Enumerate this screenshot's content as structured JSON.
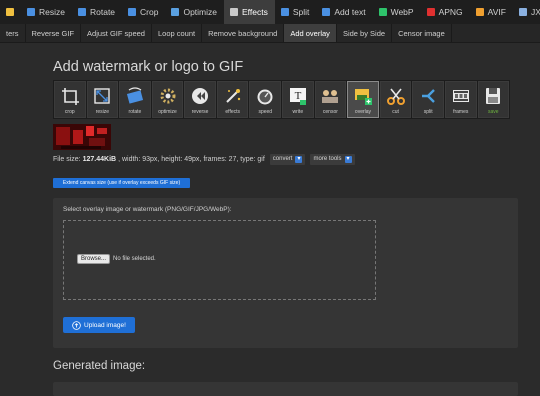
{
  "topnav": {
    "items": [
      {
        "label": "",
        "icon": "arrow-icon",
        "color": "#f0c040"
      },
      {
        "label": "Resize",
        "icon": "resize-icon",
        "color": "#4a90e2"
      },
      {
        "label": "Rotate",
        "icon": "rotate-icon",
        "color": "#4a90e2"
      },
      {
        "label": "Crop",
        "icon": "crop-icon",
        "color": "#4a90e2"
      },
      {
        "label": "Optimize",
        "icon": "optimize-icon",
        "color": "#5aa0e0"
      },
      {
        "label": "Effects",
        "icon": "effects-icon",
        "color": "#c9c9c9"
      },
      {
        "label": "Split",
        "icon": "split-icon",
        "color": "#4a90e2"
      },
      {
        "label": "Add text",
        "icon": "text-icon",
        "color": "#4a90e2"
      },
      {
        "label": "WebP",
        "icon": "webp-icon",
        "color": "#2ec36b"
      },
      {
        "label": "APNG",
        "icon": "apng-icon",
        "color": "#e03030"
      },
      {
        "label": "AVIF",
        "icon": "avif-icon",
        "color": "#f0a030"
      },
      {
        "label": "JXL",
        "icon": "jxl-icon",
        "color": "#8ab0e0"
      }
    ],
    "active_index": 5
  },
  "subnav": {
    "items": [
      "ters",
      "Reverse GIF",
      "Adjust GIF speed",
      "Loop count",
      "Remove background",
      "Add overlay",
      "Side by Side",
      "Censor image"
    ],
    "active_index": 5
  },
  "page": {
    "title": "Add watermark or logo to GIF",
    "generated_label": "Generated image:"
  },
  "tools": [
    {
      "label": "crop",
      "icon": "crop-tool-icon"
    },
    {
      "label": "resize",
      "icon": "resize-tool-icon"
    },
    {
      "label": "rotate",
      "icon": "rotate-tool-icon"
    },
    {
      "label": "optimize",
      "icon": "optimize-tool-icon"
    },
    {
      "label": "reverse",
      "icon": "reverse-tool-icon"
    },
    {
      "label": "effects",
      "icon": "effects-tool-icon"
    },
    {
      "label": "speed",
      "icon": "speed-tool-icon"
    },
    {
      "label": "write",
      "icon": "write-tool-icon"
    },
    {
      "label": "censor",
      "icon": "censor-tool-icon"
    },
    {
      "label": "overlay",
      "icon": "overlay-tool-icon"
    },
    {
      "label": "cut",
      "icon": "cut-tool-icon"
    },
    {
      "label": "split",
      "icon": "split-tool-icon"
    },
    {
      "label": "frames",
      "icon": "frames-tool-icon"
    },
    {
      "label": "save",
      "icon": "save-tool-icon"
    }
  ],
  "tools_active_index": 9,
  "fileinfo": {
    "prefix": "File size:",
    "size": "127.44KiB",
    "details": ", width: 93px, height: 49px, frames: 27, type: gif",
    "convert_label": "convert",
    "more_tools_label": "more tools"
  },
  "extend_button": "Extend canvas size (use if overlay exceeds GIF size)",
  "overlay": {
    "label": "Select overlay image or watermark (PNG/GIF/JPG/WebP):",
    "browse_label": "Browse...",
    "no_file_label": "No file selected.",
    "upload_label": "Upload image!"
  },
  "colors": {
    "accent": "#1f6fd6",
    "background": "#2b2b2b",
    "panel": "#353535"
  }
}
